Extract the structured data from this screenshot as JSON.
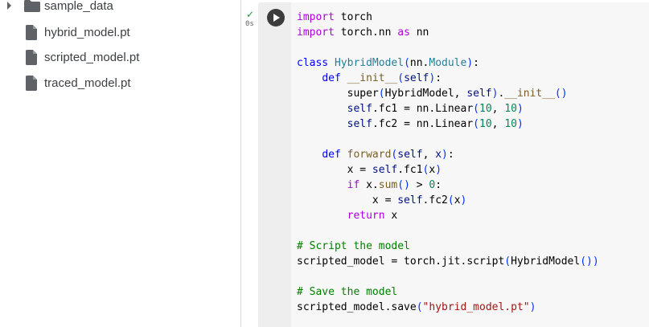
{
  "sidebar": {
    "folder": {
      "name": "sample_data",
      "icon": "folder-icon"
    },
    "files": [
      {
        "name": "hybrid_model.pt",
        "icon": "file-icon"
      },
      {
        "name": "scripted_model.pt",
        "icon": "file-icon"
      },
      {
        "name": "traced_model.pt",
        "icon": "file-icon"
      }
    ]
  },
  "cell": {
    "status_icon": "check-icon",
    "status_mark": "✓",
    "exec_time": "0s",
    "run_icon": "play-icon",
    "colors": {
      "kw": "#af00db",
      "def": "#0000ff",
      "cls": "#267f99",
      "fn": "#795e26",
      "var": "#001080",
      "num": "#098658",
      "com": "#008000",
      "str": "#a31515",
      "br": "#0431fa",
      "tx": "#000000"
    },
    "code": [
      [
        [
          "import",
          "kw"
        ],
        [
          " torch",
          "tx"
        ]
      ],
      [
        [
          "import",
          "kw"
        ],
        [
          " torch.nn ",
          "tx"
        ],
        [
          "as",
          "kw"
        ],
        [
          " nn",
          "tx"
        ]
      ],
      [],
      [
        [
          "class",
          "def"
        ],
        [
          " ",
          "tx"
        ],
        [
          "HybridModel",
          "cls"
        ],
        [
          "(",
          "br"
        ],
        [
          "nn.",
          "tx"
        ],
        [
          "Module",
          "cls"
        ],
        [
          ")",
          "br"
        ],
        [
          ":",
          "tx"
        ]
      ],
      [
        [
          "    ",
          "tx"
        ],
        [
          "def",
          "def"
        ],
        [
          " ",
          "tx"
        ],
        [
          "__init__",
          "fn"
        ],
        [
          "(",
          "br"
        ],
        [
          "self",
          "var"
        ],
        [
          ")",
          "br"
        ],
        [
          ":",
          "tx"
        ]
      ],
      [
        [
          "        super",
          "tx"
        ],
        [
          "(",
          "br"
        ],
        [
          "HybridModel, ",
          "tx"
        ],
        [
          "self",
          "var"
        ],
        [
          ")",
          "br"
        ],
        [
          ".",
          "tx"
        ],
        [
          "__init__",
          "fn"
        ],
        [
          "()",
          "br"
        ]
      ],
      [
        [
          "        ",
          "tx"
        ],
        [
          "self",
          "var"
        ],
        [
          ".fc1 = nn.Linear",
          "tx"
        ],
        [
          "(",
          "br"
        ],
        [
          "10",
          "num"
        ],
        [
          ", ",
          "tx"
        ],
        [
          "10",
          "num"
        ],
        [
          ")",
          "br"
        ]
      ],
      [
        [
          "        ",
          "tx"
        ],
        [
          "self",
          "var"
        ],
        [
          ".fc2 = nn.Linear",
          "tx"
        ],
        [
          "(",
          "br"
        ],
        [
          "10",
          "num"
        ],
        [
          ", ",
          "tx"
        ],
        [
          "10",
          "num"
        ],
        [
          ")",
          "br"
        ]
      ],
      [],
      [
        [
          "    ",
          "tx"
        ],
        [
          "def",
          "def"
        ],
        [
          " ",
          "tx"
        ],
        [
          "forward",
          "fn"
        ],
        [
          "(",
          "br"
        ],
        [
          "self",
          "var"
        ],
        [
          ", ",
          "tx"
        ],
        [
          "x",
          "var"
        ],
        [
          ")",
          "br"
        ],
        [
          ":",
          "tx"
        ]
      ],
      [
        [
          "        x = ",
          "tx"
        ],
        [
          "self",
          "var"
        ],
        [
          ".fc1",
          "tx"
        ],
        [
          "(",
          "br"
        ],
        [
          "x",
          "tx"
        ],
        [
          ")",
          "br"
        ]
      ],
      [
        [
          "        ",
          "tx"
        ],
        [
          "if",
          "kw"
        ],
        [
          " x.",
          "tx"
        ],
        [
          "sum",
          "fn"
        ],
        [
          "()",
          "br"
        ],
        [
          " > ",
          "tx"
        ],
        [
          "0",
          "num"
        ],
        [
          ":",
          "tx"
        ]
      ],
      [
        [
          "            x = ",
          "tx"
        ],
        [
          "self",
          "var"
        ],
        [
          ".fc2",
          "tx"
        ],
        [
          "(",
          "br"
        ],
        [
          "x",
          "tx"
        ],
        [
          ")",
          "br"
        ]
      ],
      [
        [
          "        ",
          "tx"
        ],
        [
          "return",
          "kw"
        ],
        [
          " x",
          "tx"
        ]
      ],
      [],
      [
        [
          "# Script the model",
          "com"
        ]
      ],
      [
        [
          "scripted_model = torch.jit.script",
          "tx"
        ],
        [
          "(",
          "br"
        ],
        [
          "HybridModel",
          "tx"
        ],
        [
          "()",
          "br"
        ],
        [
          ")",
          "br"
        ]
      ],
      [],
      [
        [
          "# Save the model",
          "com"
        ]
      ],
      [
        [
          "scripted_model.save",
          "tx"
        ],
        [
          "(",
          "br"
        ],
        [
          "\"hybrid_model.pt\"",
          "str"
        ],
        [
          ")",
          "br"
        ]
      ]
    ]
  }
}
